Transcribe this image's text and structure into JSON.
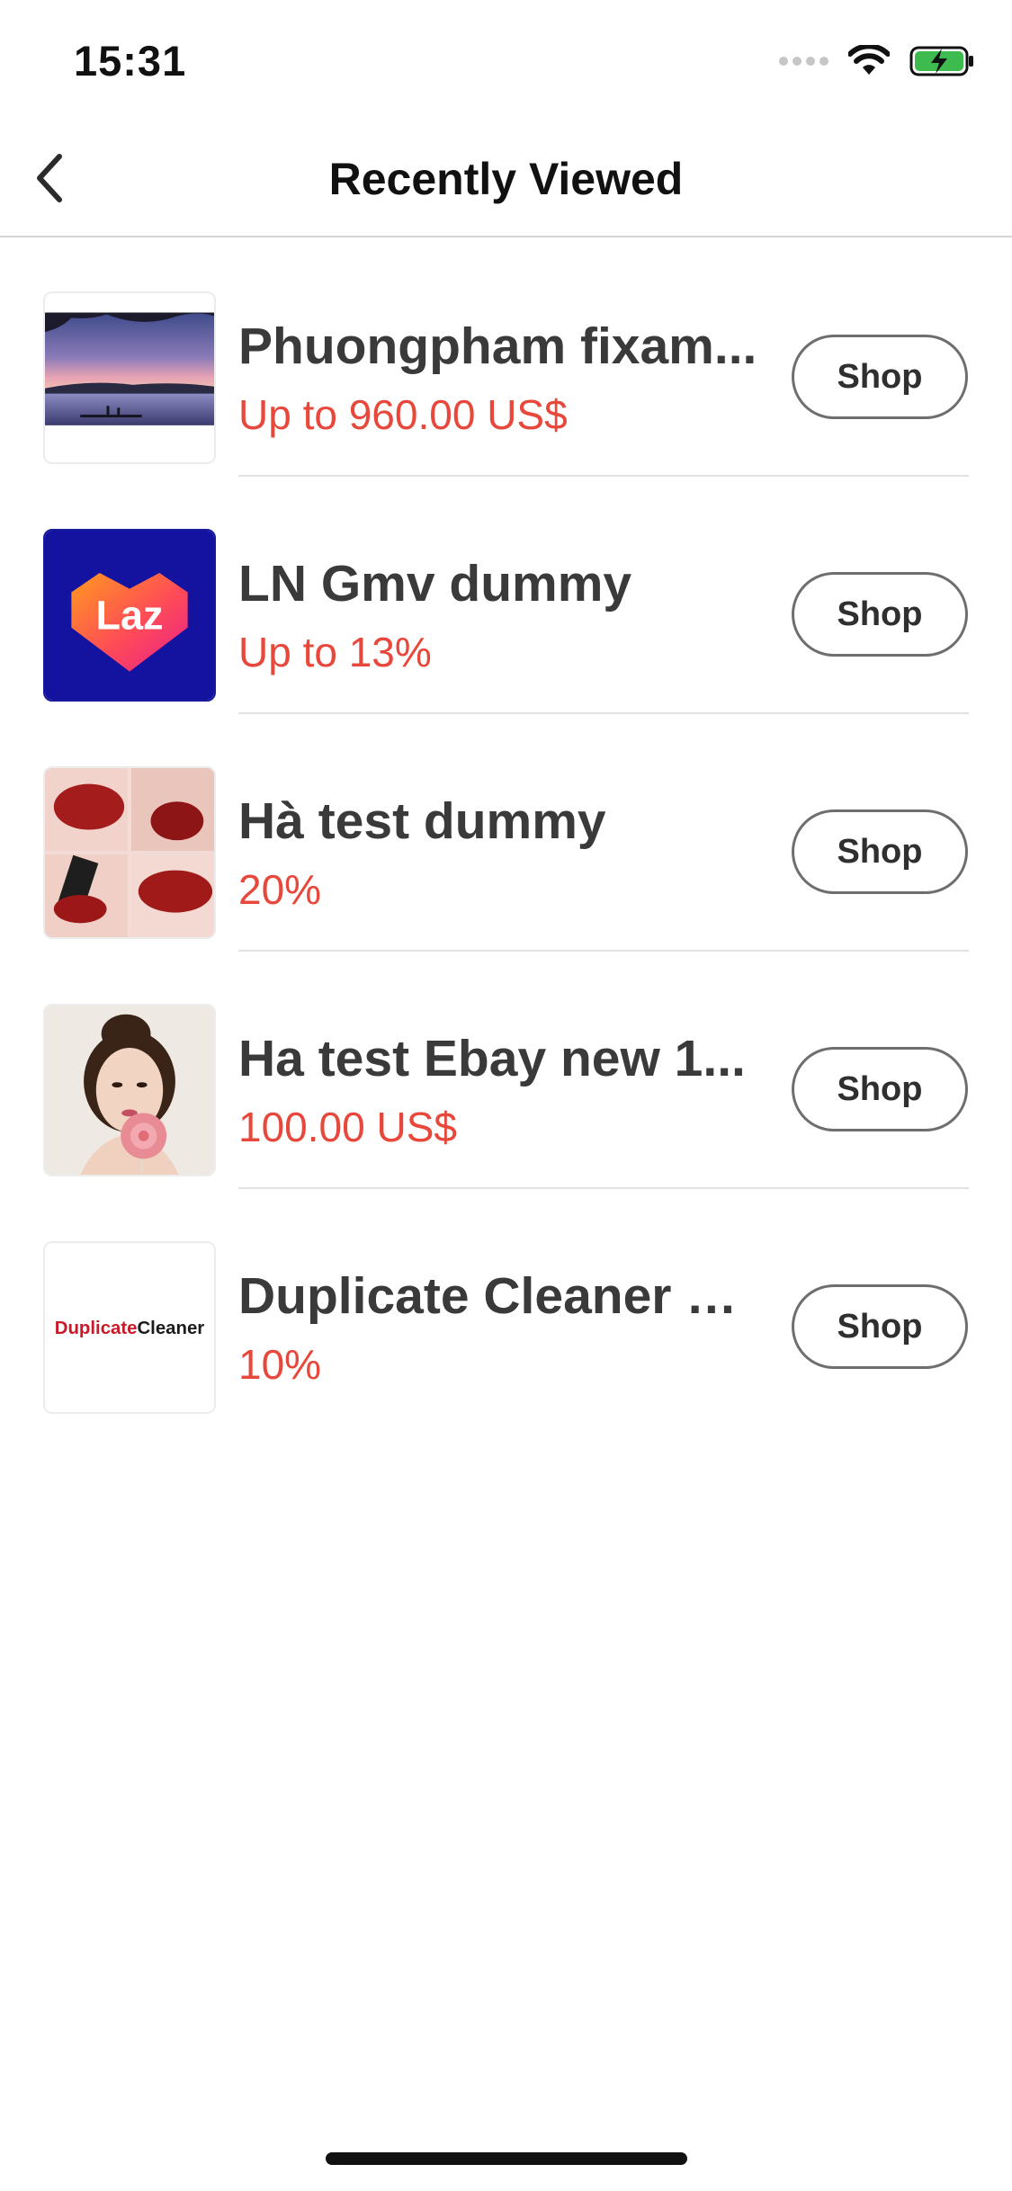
{
  "status_bar": {
    "time": "15:31",
    "icons": [
      "signal-dots-icon",
      "wifi-icon",
      "battery-charging-icon"
    ],
    "battery_color": "#3dbb4e"
  },
  "nav": {
    "title": "Recently Viewed",
    "back_icon": "chevron-left-icon"
  },
  "colors": {
    "price": "#e8473b",
    "button_border": "#6e6e6e",
    "divider": "#e2e2e2"
  },
  "items": [
    {
      "name": "Phuongpham fixam...",
      "price": "Up to 960.00 US$",
      "button": "Shop",
      "thumb": "lake-sunset-image"
    },
    {
      "name": "LN Gmv dummy",
      "price": "Up to 13%",
      "button": "Shop",
      "thumb": "lazada-logo",
      "logo_text": "Laz"
    },
    {
      "name": "Hà test dummy",
      "price": "20%",
      "button": "Shop",
      "thumb": "red-lipstick-image"
    },
    {
      "name": "Ha test Ebay new 1...",
      "price": "100.00 US$",
      "button": "Shop",
      "thumb": "woman-with-lollipop-image"
    },
    {
      "name": "Duplicate Cleaner Pro",
      "price": "10%",
      "button": "Shop",
      "thumb": "duplicate-cleaner-logo",
      "logo_text_a": "Duplicate",
      "logo_text_b": "Cleaner"
    }
  ]
}
